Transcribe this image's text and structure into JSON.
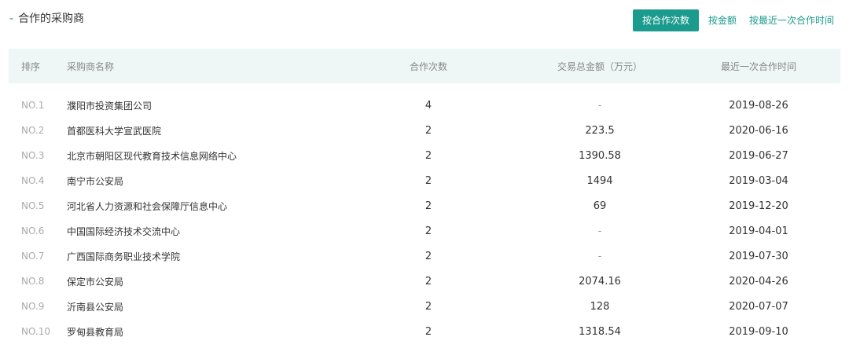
{
  "section": {
    "dash": "-",
    "title": "合作的采购商"
  },
  "sort_tabs": [
    {
      "label": "按合作次数",
      "active": true
    },
    {
      "label": "按金额",
      "active": false
    },
    {
      "label": "按最近一次合作时间",
      "active": false
    }
  ],
  "table": {
    "headers": {
      "rank": "排序",
      "name": "采购商名称",
      "count": "合作次数",
      "amount": "交易总金额（万元）",
      "date": "最近一次合作时间"
    },
    "rows": [
      {
        "rank": "NO.1",
        "name": "濮阳市投资集团公司",
        "count": "4",
        "amount": "-",
        "date": "2019-08-26"
      },
      {
        "rank": "NO.2",
        "name": "首都医科大学宣武医院",
        "count": "2",
        "amount": "223.5",
        "date": "2020-06-16"
      },
      {
        "rank": "NO.3",
        "name": "北京市朝阳区现代教育技术信息网络中心",
        "count": "2",
        "amount": "1390.58",
        "date": "2019-06-27"
      },
      {
        "rank": "NO.4",
        "name": "南宁市公安局",
        "count": "2",
        "amount": "1494",
        "date": "2019-03-04"
      },
      {
        "rank": "NO.5",
        "name": "河北省人力资源和社会保障厅信息中心",
        "count": "2",
        "amount": "69",
        "date": "2019-12-20"
      },
      {
        "rank": "NO.6",
        "name": "中国国际经济技术交流中心",
        "count": "2",
        "amount": "-",
        "date": "2019-04-01"
      },
      {
        "rank": "NO.7",
        "name": "广西国际商务职业技术学院",
        "count": "2",
        "amount": "-",
        "date": "2019-07-30"
      },
      {
        "rank": "NO.8",
        "name": "保定市公安局",
        "count": "2",
        "amount": "2074.16",
        "date": "2020-04-26"
      },
      {
        "rank": "NO.9",
        "name": "沂南县公安局",
        "count": "2",
        "amount": "128",
        "date": "2020-07-07"
      },
      {
        "rank": "NO.10",
        "name": "罗甸县教育局",
        "count": "2",
        "amount": "1318.54",
        "date": "2019-09-10"
      }
    ]
  },
  "colors": {
    "accent": "#1a9b8d",
    "header_bg": "#eef6f6"
  }
}
